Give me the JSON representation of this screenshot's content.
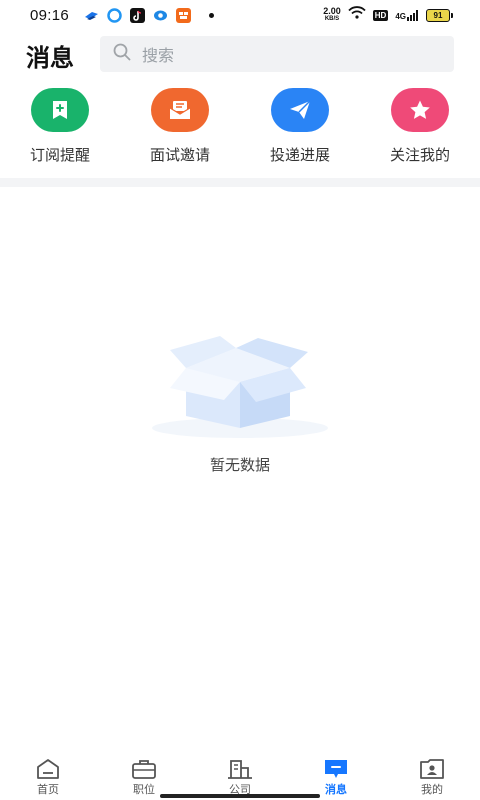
{
  "status": {
    "time": "09:16",
    "net_speed": "2.00",
    "net_unit": "KB/S",
    "hd": "HD",
    "signal": "4G",
    "battery": "91"
  },
  "header": {
    "title": "消息",
    "search_placeholder": "搜索"
  },
  "quick_actions": [
    {
      "label": "订阅提醒",
      "icon": "bookmark-plus-icon",
      "color": "#19b36b"
    },
    {
      "label": "面试邀请",
      "icon": "envelope-open-icon",
      "color": "#f0682f"
    },
    {
      "label": "投递进展",
      "icon": "paper-plane-icon",
      "color": "#2a84f5"
    },
    {
      "label": "关注我的",
      "icon": "star-icon",
      "color": "#ef4a78"
    }
  ],
  "empty_state": {
    "icon": "empty-box-icon",
    "text": "暂无数据"
  },
  "bottom_nav": {
    "active": "消息",
    "active_color": "#1677ff",
    "items": [
      {
        "label": "首页",
        "icon": "home-icon"
      },
      {
        "label": "职位",
        "icon": "briefcase-icon"
      },
      {
        "label": "公司",
        "icon": "building-icon"
      },
      {
        "label": "消息",
        "icon": "message-icon"
      },
      {
        "label": "我的",
        "icon": "profile-card-icon"
      }
    ]
  }
}
